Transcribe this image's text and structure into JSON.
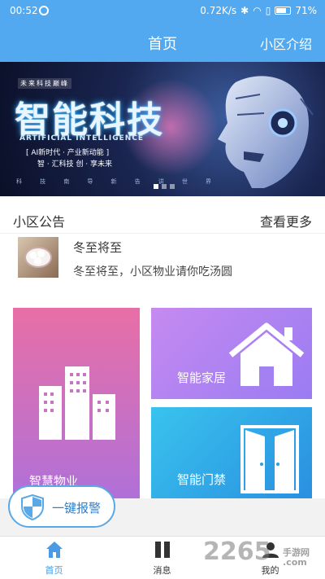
{
  "status_bar": {
    "time": "00:52",
    "net_speed": "0.72K/s",
    "icons": [
      "bluetooth-icon",
      "wifi-icon",
      "no-sim-icon",
      "battery-icon"
    ],
    "battery": "71%"
  },
  "header": {
    "title": "首页",
    "right_link": "小区介绍"
  },
  "banner": {
    "small_tag": "未来科技巅峰",
    "headline": "智能科技",
    "subtitle_en": "ARTIFICIAL INTELLIGENCE",
    "slogan_line1": "[ AI新时代 · 产业新动能 ]",
    "slogan_line2": "智 · 汇科技 创 · 享未来",
    "bottom_words": [
      "科",
      "技",
      "南",
      "导",
      "新",
      "告",
      "讲",
      "世",
      "界"
    ],
    "pages": 3,
    "active_page": 1
  },
  "notice": {
    "section_title": "小区公告",
    "more_label": "查看更多",
    "items": [
      {
        "title": "冬至将至",
        "desc": "冬至将至，小区物业请你吃汤圆",
        "thumb": "tangyuan-image"
      }
    ]
  },
  "tiles": [
    {
      "label": "智慧物业",
      "icon": "buildings-icon"
    },
    {
      "label": "智能家居",
      "icon": "house-icon"
    },
    {
      "label": "智能门禁",
      "icon": "door-icon"
    }
  ],
  "sos_button": {
    "label": "一键报警",
    "icon": "shield-icon"
  },
  "tabbar": {
    "tabs": [
      {
        "label": "首页",
        "icon": "home-icon",
        "active": true
      },
      {
        "label": "消息",
        "icon": "message-icon",
        "active": false
      },
      {
        "label": "我的",
        "icon": "user-icon",
        "active": false
      }
    ]
  },
  "watermark": {
    "text": "2265",
    "site": "手游网",
    "domain": ".com"
  },
  "colors": {
    "header": "#52a9f0",
    "tile_property": "#e86fa6",
    "tile_home": "#b48af0",
    "tile_door": "#2aa8e8",
    "tab_active": "#4a9be6"
  }
}
